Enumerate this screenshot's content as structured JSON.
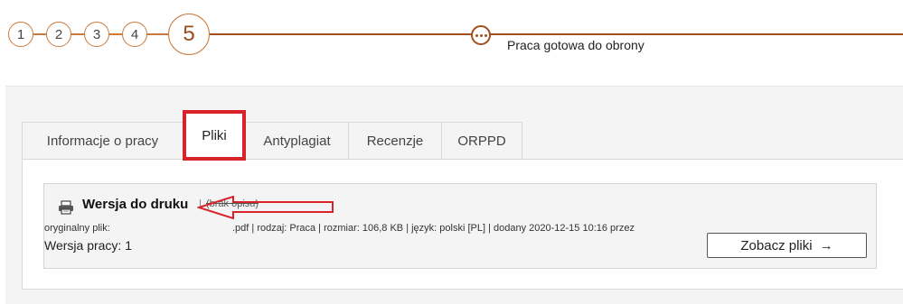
{
  "stepper": {
    "steps": [
      "1",
      "2",
      "3",
      "4",
      "5"
    ],
    "current_step": "5",
    "status_text": "Praca gotowa do obrony",
    "accent": "#a14f1c"
  },
  "tabs": [
    {
      "label": "Informacje o pracy",
      "active": false
    },
    {
      "label": "Pliki",
      "active": true
    },
    {
      "label": "Antyplagiat",
      "active": false
    },
    {
      "label": "Recenzje",
      "active": false
    },
    {
      "label": "ORPPD",
      "active": false
    }
  ],
  "file": {
    "icon": "printer-icon",
    "title": "Wersja do druku",
    "separator": "|",
    "description": "(brak opisu)",
    "meta_label": "oryginalny plik:",
    "meta_rest": ".pdf | rodzaj: Praca | rozmiar: 106,8 KB | język: polski [PL] | dodany 2020-12-15 10:16 przez",
    "version_text": "Wersja pracy: 1",
    "view_button": "Zobacz pliki",
    "view_button_icon": "→"
  },
  "colors": {
    "highlight": "#d8232a",
    "panel_bg": "#f4f4f4"
  }
}
